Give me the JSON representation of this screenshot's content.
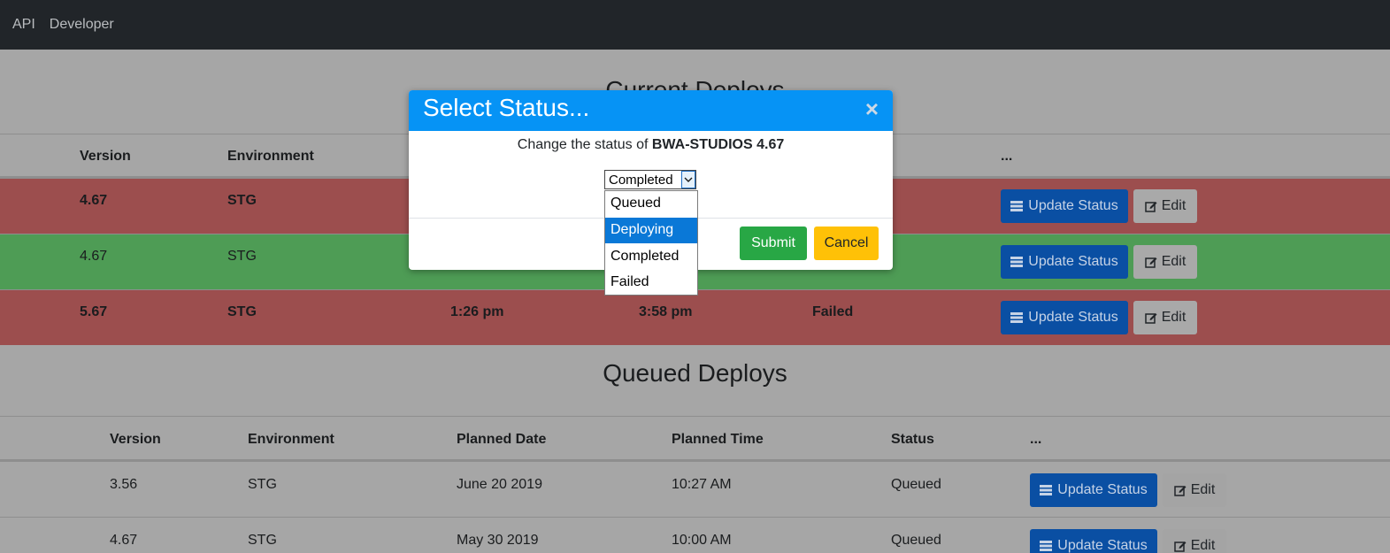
{
  "nav": {
    "links": [
      "API",
      "Developer"
    ]
  },
  "current": {
    "title": "Current Deploys",
    "columns": [
      "Version",
      "Environment",
      "",
      "",
      "",
      "..."
    ],
    "rows": [
      {
        "version": "4.67",
        "environment": "STG",
        "start": "",
        "end": "",
        "status": ""
      },
      {
        "version": "4.67",
        "environment": "STG",
        "start": "",
        "end": "",
        "status": ""
      },
      {
        "version": "5.67",
        "environment": "STG",
        "start": "1:26 pm",
        "end": "3:58 pm",
        "status": "Failed"
      }
    ]
  },
  "queued": {
    "title": "Queued Deploys",
    "columns": [
      "Version",
      "Environment",
      "Planned Date",
      "Planned Time",
      "Status",
      "..."
    ],
    "rows": [
      {
        "version": "3.56",
        "environment": "STG",
        "date": "June 20 2019",
        "time": "10:27 AM",
        "status": "Queued"
      },
      {
        "version": "4.67",
        "environment": "STG",
        "date": "May 30 2019",
        "time": "10:00 AM",
        "status": "Queued"
      }
    ]
  },
  "buttons": {
    "update_status": "Update Status",
    "edit": "Edit"
  },
  "modal": {
    "title": "Select Status...",
    "close": "×",
    "text_prefix": "Change the status of ",
    "text_target": "BWA-STUDIOS 4.67",
    "select_value": "Completed",
    "options": [
      "Queued",
      "Deploying",
      "Completed",
      "Failed"
    ],
    "highlighted_option": "Deploying",
    "submit": "Submit",
    "cancel": "Cancel"
  },
  "colors": {
    "navbar": "#212529",
    "failed_row": "#9c4e4e",
    "success_row": "#4e9c55",
    "modal_header": "#0693f5",
    "primary_button": "#0a4fa3",
    "submit_button": "#28a745",
    "cancel_button": "#ffc107"
  }
}
